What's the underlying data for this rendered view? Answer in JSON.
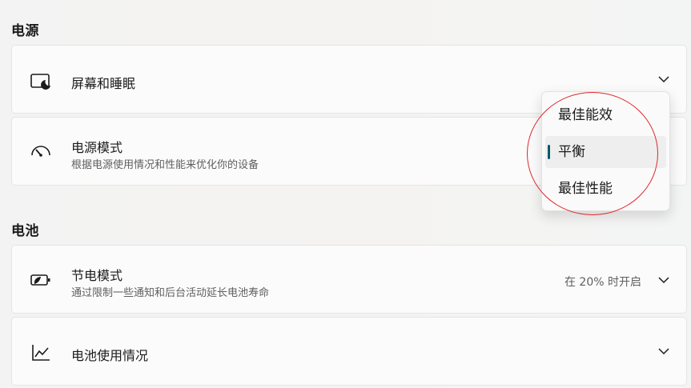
{
  "power_section": {
    "title": "电源"
  },
  "screen_sleep": {
    "title": "屏幕和睡眠"
  },
  "power_mode": {
    "title": "电源模式",
    "subtitle": "根据电源使用情况和性能来优化你的设备",
    "options": [
      "最佳能效",
      "平衡",
      "最佳性能"
    ],
    "selected": "平衡"
  },
  "battery_section": {
    "title": "电池"
  },
  "battery_saver": {
    "title": "节电模式",
    "subtitle": "通过限制一些通知和后台活动延长电池寿命",
    "status": "在 20% 时开启"
  },
  "battery_usage": {
    "title": "电池使用情况"
  },
  "icons": {
    "screen_sleep": "screen-sleep-icon",
    "power_mode": "speedometer-icon",
    "battery_saver": "battery-leaf-icon",
    "battery_usage": "line-chart-icon",
    "expand": "chevron-down-icon"
  },
  "colors": {
    "selection_indicator": "#005a6e",
    "annotation_circle": "#e0252b"
  }
}
